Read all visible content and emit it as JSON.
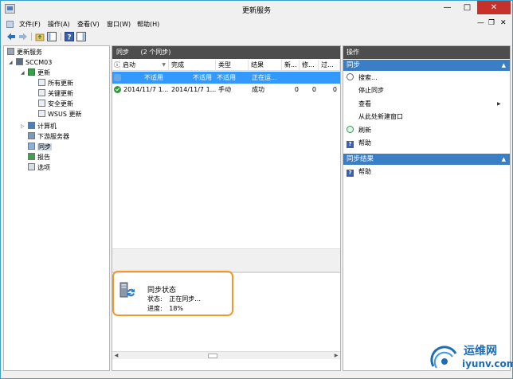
{
  "window": {
    "title": "更新服务"
  },
  "menu": [
    {
      "label": "文件(F)"
    },
    {
      "label": "操作(A)"
    },
    {
      "label": "查看(V)"
    },
    {
      "label": "窗口(W)"
    },
    {
      "label": "帮助(H)"
    }
  ],
  "tree": {
    "root": "更新服务",
    "server": "SCCM03",
    "updates": "更新",
    "all_updates": "所有更新",
    "critical_updates": "关键更新",
    "security_updates": "安全更新",
    "wsus_updates": "WSUS 更新",
    "computers": "计算机",
    "downstream": "下游服务器",
    "sync": "同步",
    "reports": "报告",
    "options": "选项"
  },
  "center": {
    "header_title": "同步",
    "header_count": "(2 个同步)",
    "columns": [
      "启动",
      "完成",
      "类型",
      "结果",
      "新...",
      "修...",
      "过..."
    ],
    "rows": [
      {
        "start": "不适用",
        "finish": "不适用",
        "type": "不适用",
        "result": "正在运...",
        "new": "",
        "revised": "",
        "expired": ""
      },
      {
        "start": "2014/11/7 1...",
        "finish": "2014/11/7 1...",
        "type": "手动",
        "result": "成功",
        "new": "0",
        "revised": "0",
        "expired": "0"
      }
    ],
    "detail": {
      "title": "同步状态",
      "status_label": "状态:",
      "status_value": "正在同步...",
      "progress_label": "进度:",
      "progress_value": "18%"
    }
  },
  "actions": {
    "header": "操作",
    "section1_title": "同步",
    "section1_items": [
      "搜索...",
      "停止同步",
      "查看",
      "从此处新建窗口",
      "刷新",
      "帮助"
    ],
    "section2_title": "同步结果",
    "section2_items": [
      "帮助"
    ]
  },
  "watermark": {
    "cn": "运维网",
    "en": "iyunv.com"
  },
  "colors": {
    "selection": "#3399ff",
    "section_header": "#3a7fc6",
    "panel_header": "#4d4d4d",
    "highlight": "#f0972e",
    "close_button": "#c7312a"
  }
}
